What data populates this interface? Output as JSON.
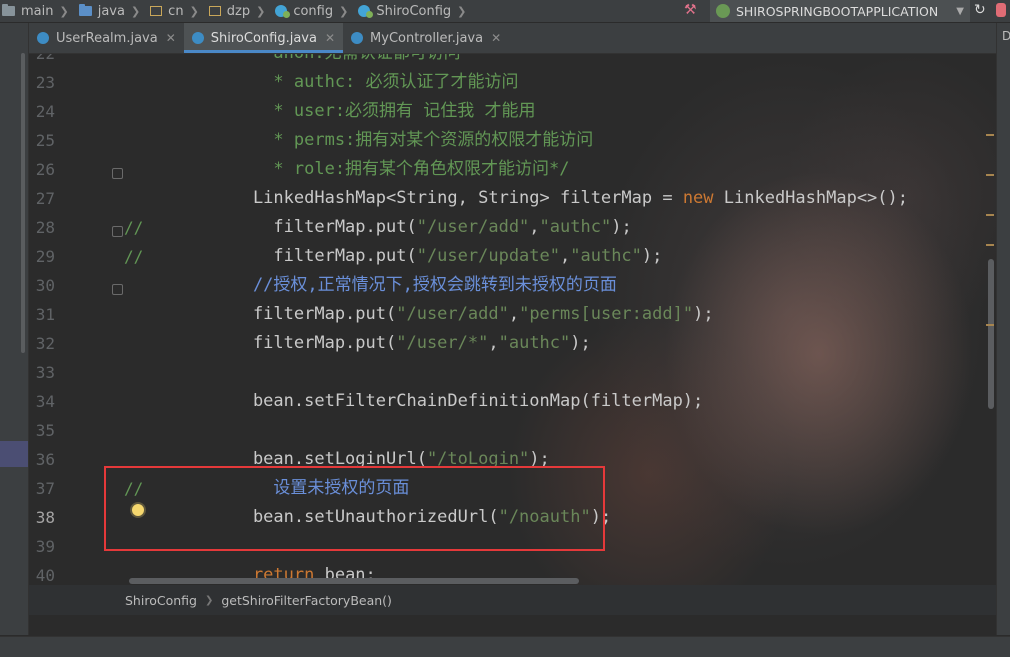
{
  "breadcrumb": [
    "main",
    "java",
    "cn",
    "dzp",
    "config",
    "ShiroConfig"
  ],
  "run_config": "SHIROSPRINGBOOTAPPLICATION",
  "tabs": [
    "UserRealm.java",
    "ShiroConfig.java",
    "MyController.java"
  ],
  "active_tab": 1,
  "side_panel_label": "D",
  "code_lines": [
    {
      "n": "22",
      "t": [
        [
          "cmt",
          "      anon:无需认证都可访问"
        ]
      ]
    },
    {
      "n": "23",
      "t": [
        [
          "cmt",
          "      * authc: 必须认证了才能访问"
        ]
      ]
    },
    {
      "n": "24",
      "t": [
        [
          "cmt",
          "      * user:必须拥有 记住我 才能用"
        ]
      ]
    },
    {
      "n": "25",
      "t": [
        [
          "cmt",
          "      * perms:拥有对某个资源的权限才能访问"
        ]
      ]
    },
    {
      "n": "26",
      "t": [
        [
          "cmt",
          "      * role:拥有某个角色权限才能访问*/"
        ]
      ]
    },
    {
      "n": "27",
      "t": [
        [
          "plain",
          "    LinkedHashMap<String, String> filterMap = "
        ],
        [
          "kw",
          "new"
        ],
        [
          "plain",
          " LinkedHashMap<>();"
        ]
      ]
    },
    {
      "n": "28",
      "m": "//",
      "t": [
        [
          "plain",
          "      filterMap.put("
        ],
        [
          "str",
          "\"/user/add\""
        ],
        [
          "plain",
          ","
        ],
        [
          "str",
          "\"authc\""
        ],
        [
          "plain",
          ");"
        ]
      ]
    },
    {
      "n": "29",
      "m": "//",
      "t": [
        [
          "plain",
          "      filterMap.put("
        ],
        [
          "str",
          "\"/user/update\""
        ],
        [
          "plain",
          ","
        ],
        [
          "str",
          "\"authc\""
        ],
        [
          "plain",
          ");"
        ]
      ]
    },
    {
      "n": "30",
      "t": [
        [
          "cmtb",
          "    //授权,正常情况下,授权会跳转到未授权的页面"
        ]
      ]
    },
    {
      "n": "31",
      "t": [
        [
          "plain",
          "    filterMap.put("
        ],
        [
          "str",
          "\"/user/add\""
        ],
        [
          "plain",
          ","
        ],
        [
          "str",
          "\"perms[user:add]\""
        ],
        [
          "plain",
          ");"
        ]
      ]
    },
    {
      "n": "32",
      "t": [
        [
          "plain",
          "    filterMap.put("
        ],
        [
          "str",
          "\"/user/*\""
        ],
        [
          "plain",
          ","
        ],
        [
          "str",
          "\"authc\""
        ],
        [
          "plain",
          ");"
        ]
      ]
    },
    {
      "n": "33",
      "t": []
    },
    {
      "n": "34",
      "t": [
        [
          "plain",
          "    bean.setFilterChainDefinitionMap(filterMap);"
        ]
      ]
    },
    {
      "n": "35",
      "t": []
    },
    {
      "n": "36",
      "t": [
        [
          "plain",
          "    bean.setLoginUrl("
        ],
        [
          "str",
          "\"/toLogin\""
        ],
        [
          "plain",
          ");"
        ]
      ]
    },
    {
      "n": "37",
      "m": "//",
      "t": [
        [
          "cmtb",
          "      设置未授权的页面"
        ]
      ]
    },
    {
      "n": "38",
      "t": [
        [
          "plain",
          "    bean.setUnauthorizedUrl("
        ],
        [
          "str",
          "\"/noauth\""
        ],
        [
          "plain",
          ");"
        ]
      ]
    },
    {
      "n": "39",
      "t": []
    },
    {
      "n": "40",
      "t": [
        [
          "kw",
          "    return"
        ],
        [
          "plain",
          " bean;"
        ]
      ]
    }
  ],
  "bottom_breadcrumb": [
    "ShiroConfig",
    "getShiroFilterFactoryBean()"
  ]
}
